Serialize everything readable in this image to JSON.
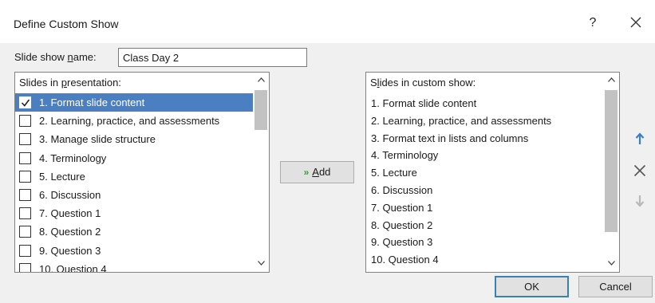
{
  "dialog": {
    "title": "Define Custom Show",
    "help_label": "?",
    "close_icon": "close-icon"
  },
  "name_field": {
    "label_pre": "Slide show ",
    "label_u": "n",
    "label_post": "ame:",
    "value": "Class Day 2"
  },
  "left_list": {
    "header_pre": "Slides in ",
    "header_u": "p",
    "header_post": "resentation:",
    "items": [
      {
        "label": "1. Format slide content",
        "checked": true,
        "selected": true
      },
      {
        "label": "2. Learning, practice, and assessments",
        "checked": false
      },
      {
        "label": "3. Manage slide structure",
        "checked": false
      },
      {
        "label": "4. Terminology",
        "checked": false
      },
      {
        "label": "5. Lecture",
        "checked": false
      },
      {
        "label": "6. Discussion",
        "checked": false
      },
      {
        "label": "7. Question 1",
        "checked": false
      },
      {
        "label": "8. Question 2",
        "checked": false
      },
      {
        "label": "9. Question 3",
        "checked": false
      },
      {
        "label": "10. Question 4",
        "checked": false
      }
    ]
  },
  "right_list": {
    "header_pre": "S",
    "header_u": "l",
    "header_post": "ides in custom show:",
    "items": [
      "1. Format slide content",
      "2. Learning, practice, and assessments",
      "3. Format text in lists and columns",
      "4. Terminology",
      "5. Lecture",
      "6. Discussion",
      "7. Question 1",
      "8. Question 2",
      "9. Question 3",
      "10. Question 4"
    ]
  },
  "add_button": {
    "arrows": "»",
    "label_u": "A",
    "label_post": "dd"
  },
  "side_buttons": {
    "up": "move-up-icon",
    "remove": "remove-icon",
    "down": "move-down-icon"
  },
  "footer": {
    "ok_label": "OK",
    "cancel_label": "Cancel"
  },
  "colors": {
    "selection": "#4a7fc1",
    "accent_arrow": "#3a7fc6",
    "add_arrow": "#3a9a3a"
  }
}
